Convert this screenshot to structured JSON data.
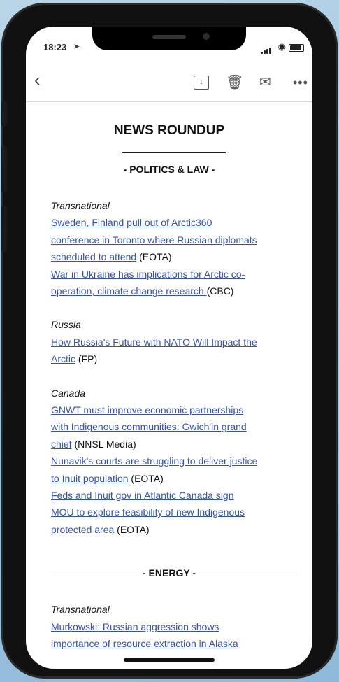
{
  "status": {
    "time": "18:23"
  },
  "toolbar": {
    "more_label": "•••"
  },
  "email": {
    "title": "NEWS ROUNDUP",
    "sections": [
      {
        "heading": "- POLITICS & LAW -",
        "groups": [
          {
            "region": "Transnational",
            "items": [
              {
                "lines": [
                  "Sweden, Finland pull out of Arctic360",
                  "conference in Toronto where Russian diplomats",
                  "scheduled to attend"
                ],
                "source": " (EOTA)"
              },
              {
                "lines": [
                  "War in Ukraine has implications for Arctic co-",
                  "operation, climate change research "
                ],
                "source": "(CBC)"
              }
            ]
          },
          {
            "region": "Russia",
            "items": [
              {
                "lines": [
                  "How Russia's Future with NATO Will Impact the",
                  "Arctic"
                ],
                "source": " (FP)"
              }
            ]
          },
          {
            "region": "Canada",
            "items": [
              {
                "lines": [
                  "GNWT must improve economic partnerships",
                  "with Indigenous communities: Gwich'in grand",
                  "chief"
                ],
                "source": " (NNSL Media)"
              },
              {
                "lines": [
                  "Nunavik's courts are struggling to deliver justice",
                  "to Inuit population "
                ],
                "source": "(EOTA)"
              },
              {
                "lines": [
                  "Feds and Inuit gov in Atlantic Canada sign",
                  "MOU to explore feasibility of new Indigenous",
                  "protected area"
                ],
                "source": " (EOTA)"
              }
            ]
          }
        ]
      },
      {
        "heading": "- ENERGY -",
        "groups": [
          {
            "region": "Transnational",
            "items": [
              {
                "lines": [
                  "Murkowski: Russian aggression shows",
                  "importance of resource extraction in Alaska"
                ],
                "source": ""
              }
            ]
          }
        ]
      }
    ]
  }
}
